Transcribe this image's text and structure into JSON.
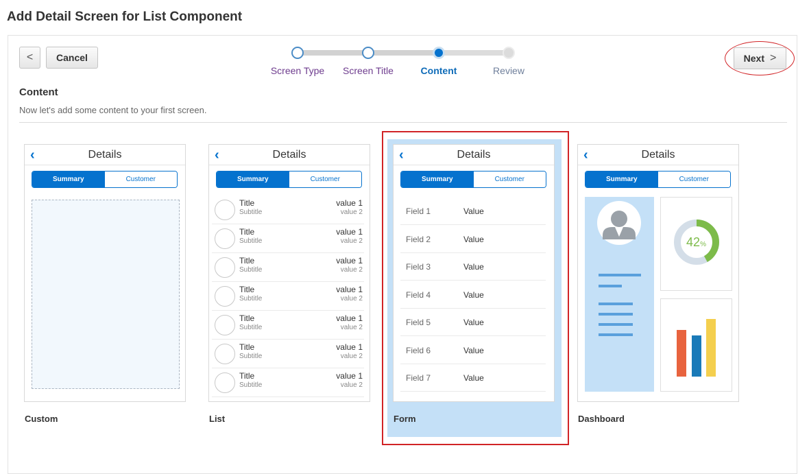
{
  "page_title": "Add Detail Screen for List Component",
  "toolbar": {
    "back_glyph": "<",
    "cancel_label": "Cancel",
    "next_label": "Next",
    "next_glyph": ">"
  },
  "train": {
    "steps": [
      {
        "label": "Screen Type",
        "state": "visited"
      },
      {
        "label": "Screen Title",
        "state": "visited"
      },
      {
        "label": "Content",
        "state": "current"
      },
      {
        "label": "Review",
        "state": "future"
      }
    ]
  },
  "section": {
    "title": "Content",
    "description": "Now let's add some content to your first screen."
  },
  "templates": [
    {
      "caption": "Custom",
      "header": "Details",
      "seg_on": "Summary",
      "seg_off": "Customer",
      "selected": false
    },
    {
      "caption": "List",
      "header": "Details",
      "seg_on": "Summary",
      "seg_off": "Customer",
      "selected": false
    },
    {
      "caption": "Form",
      "header": "Details",
      "seg_on": "Summary",
      "seg_off": "Customer",
      "selected": true
    },
    {
      "caption": "Dashboard",
      "header": "Details",
      "seg_on": "Summary",
      "seg_off": "Customer",
      "selected": false
    }
  ],
  "list_rows": [
    {
      "title": "Title",
      "subtitle": "Subtitle",
      "value1": "value 1",
      "value2": "value 2"
    },
    {
      "title": "Title",
      "subtitle": "Subtitle",
      "value1": "value 1",
      "value2": "value 2"
    },
    {
      "title": "Title",
      "subtitle": "Subtitle",
      "value1": "value 1",
      "value2": "value 2"
    },
    {
      "title": "Title",
      "subtitle": "Subtitle",
      "value1": "value 1",
      "value2": "value 2"
    },
    {
      "title": "Title",
      "subtitle": "Subtitle",
      "value1": "value 1",
      "value2": "value 2"
    },
    {
      "title": "Title",
      "subtitle": "Subtitle",
      "value1": "value 1",
      "value2": "value 2"
    },
    {
      "title": "Title",
      "subtitle": "Subtitle",
      "value1": "value 1",
      "value2": "value 2"
    }
  ],
  "form_rows": [
    {
      "field": "Field 1",
      "value": "Value"
    },
    {
      "field": "Field 2",
      "value": "Value"
    },
    {
      "field": "Field 3",
      "value": "Value"
    },
    {
      "field": "Field 4",
      "value": "Value"
    },
    {
      "field": "Field 5",
      "value": "Value"
    },
    {
      "field": "Field 6",
      "value": "Value"
    },
    {
      "field": "Field 7",
      "value": "Value"
    }
  ],
  "dashboard": {
    "donut_number": "42",
    "donut_unit": "%",
    "donut_fraction": 0.42
  },
  "colors": {
    "accent": "#0572ce",
    "selection": "#d12326",
    "selected_bg": "#c4e0f7",
    "bar_red": "#e8633e",
    "bar_blue": "#1a7ab8",
    "bar_yellow": "#f4cf4e",
    "donut_green": "#7dbb4a"
  }
}
